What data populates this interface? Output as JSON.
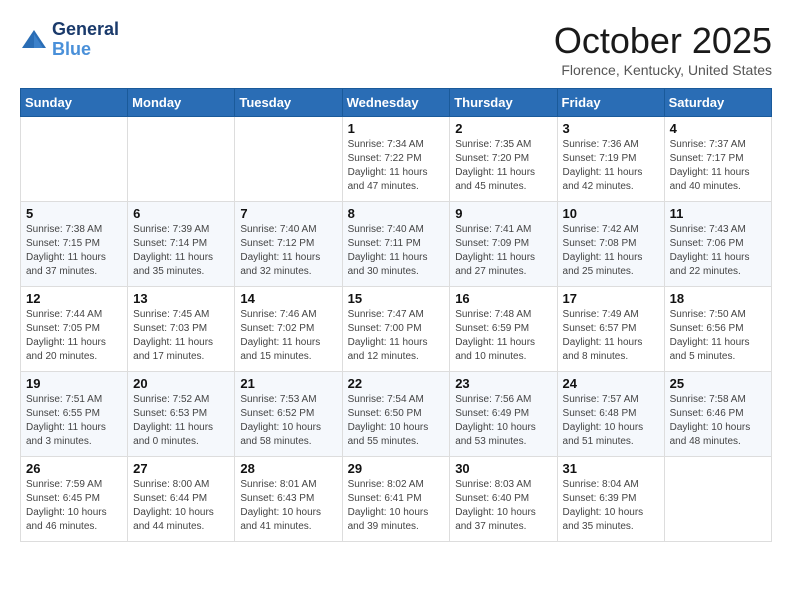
{
  "header": {
    "logo_line1": "General",
    "logo_line2": "Blue",
    "month": "October 2025",
    "location": "Florence, Kentucky, United States"
  },
  "weekdays": [
    "Sunday",
    "Monday",
    "Tuesday",
    "Wednesday",
    "Thursday",
    "Friday",
    "Saturday"
  ],
  "weeks": [
    [
      {
        "day": "",
        "info": ""
      },
      {
        "day": "",
        "info": ""
      },
      {
        "day": "",
        "info": ""
      },
      {
        "day": "1",
        "info": "Sunrise: 7:34 AM\nSunset: 7:22 PM\nDaylight: 11 hours\nand 47 minutes."
      },
      {
        "day": "2",
        "info": "Sunrise: 7:35 AM\nSunset: 7:20 PM\nDaylight: 11 hours\nand 45 minutes."
      },
      {
        "day": "3",
        "info": "Sunrise: 7:36 AM\nSunset: 7:19 PM\nDaylight: 11 hours\nand 42 minutes."
      },
      {
        "day": "4",
        "info": "Sunrise: 7:37 AM\nSunset: 7:17 PM\nDaylight: 11 hours\nand 40 minutes."
      }
    ],
    [
      {
        "day": "5",
        "info": "Sunrise: 7:38 AM\nSunset: 7:15 PM\nDaylight: 11 hours\nand 37 minutes."
      },
      {
        "day": "6",
        "info": "Sunrise: 7:39 AM\nSunset: 7:14 PM\nDaylight: 11 hours\nand 35 minutes."
      },
      {
        "day": "7",
        "info": "Sunrise: 7:40 AM\nSunset: 7:12 PM\nDaylight: 11 hours\nand 32 minutes."
      },
      {
        "day": "8",
        "info": "Sunrise: 7:40 AM\nSunset: 7:11 PM\nDaylight: 11 hours\nand 30 minutes."
      },
      {
        "day": "9",
        "info": "Sunrise: 7:41 AM\nSunset: 7:09 PM\nDaylight: 11 hours\nand 27 minutes."
      },
      {
        "day": "10",
        "info": "Sunrise: 7:42 AM\nSunset: 7:08 PM\nDaylight: 11 hours\nand 25 minutes."
      },
      {
        "day": "11",
        "info": "Sunrise: 7:43 AM\nSunset: 7:06 PM\nDaylight: 11 hours\nand 22 minutes."
      }
    ],
    [
      {
        "day": "12",
        "info": "Sunrise: 7:44 AM\nSunset: 7:05 PM\nDaylight: 11 hours\nand 20 minutes."
      },
      {
        "day": "13",
        "info": "Sunrise: 7:45 AM\nSunset: 7:03 PM\nDaylight: 11 hours\nand 17 minutes."
      },
      {
        "day": "14",
        "info": "Sunrise: 7:46 AM\nSunset: 7:02 PM\nDaylight: 11 hours\nand 15 minutes."
      },
      {
        "day": "15",
        "info": "Sunrise: 7:47 AM\nSunset: 7:00 PM\nDaylight: 11 hours\nand 12 minutes."
      },
      {
        "day": "16",
        "info": "Sunrise: 7:48 AM\nSunset: 6:59 PM\nDaylight: 11 hours\nand 10 minutes."
      },
      {
        "day": "17",
        "info": "Sunrise: 7:49 AM\nSunset: 6:57 PM\nDaylight: 11 hours\nand 8 minutes."
      },
      {
        "day": "18",
        "info": "Sunrise: 7:50 AM\nSunset: 6:56 PM\nDaylight: 11 hours\nand 5 minutes."
      }
    ],
    [
      {
        "day": "19",
        "info": "Sunrise: 7:51 AM\nSunset: 6:55 PM\nDaylight: 11 hours\nand 3 minutes."
      },
      {
        "day": "20",
        "info": "Sunrise: 7:52 AM\nSunset: 6:53 PM\nDaylight: 11 hours\nand 0 minutes."
      },
      {
        "day": "21",
        "info": "Sunrise: 7:53 AM\nSunset: 6:52 PM\nDaylight: 10 hours\nand 58 minutes."
      },
      {
        "day": "22",
        "info": "Sunrise: 7:54 AM\nSunset: 6:50 PM\nDaylight: 10 hours\nand 55 minutes."
      },
      {
        "day": "23",
        "info": "Sunrise: 7:56 AM\nSunset: 6:49 PM\nDaylight: 10 hours\nand 53 minutes."
      },
      {
        "day": "24",
        "info": "Sunrise: 7:57 AM\nSunset: 6:48 PM\nDaylight: 10 hours\nand 51 minutes."
      },
      {
        "day": "25",
        "info": "Sunrise: 7:58 AM\nSunset: 6:46 PM\nDaylight: 10 hours\nand 48 minutes."
      }
    ],
    [
      {
        "day": "26",
        "info": "Sunrise: 7:59 AM\nSunset: 6:45 PM\nDaylight: 10 hours\nand 46 minutes."
      },
      {
        "day": "27",
        "info": "Sunrise: 8:00 AM\nSunset: 6:44 PM\nDaylight: 10 hours\nand 44 minutes."
      },
      {
        "day": "28",
        "info": "Sunrise: 8:01 AM\nSunset: 6:43 PM\nDaylight: 10 hours\nand 41 minutes."
      },
      {
        "day": "29",
        "info": "Sunrise: 8:02 AM\nSunset: 6:41 PM\nDaylight: 10 hours\nand 39 minutes."
      },
      {
        "day": "30",
        "info": "Sunrise: 8:03 AM\nSunset: 6:40 PM\nDaylight: 10 hours\nand 37 minutes."
      },
      {
        "day": "31",
        "info": "Sunrise: 8:04 AM\nSunset: 6:39 PM\nDaylight: 10 hours\nand 35 minutes."
      },
      {
        "day": "",
        "info": ""
      }
    ]
  ]
}
